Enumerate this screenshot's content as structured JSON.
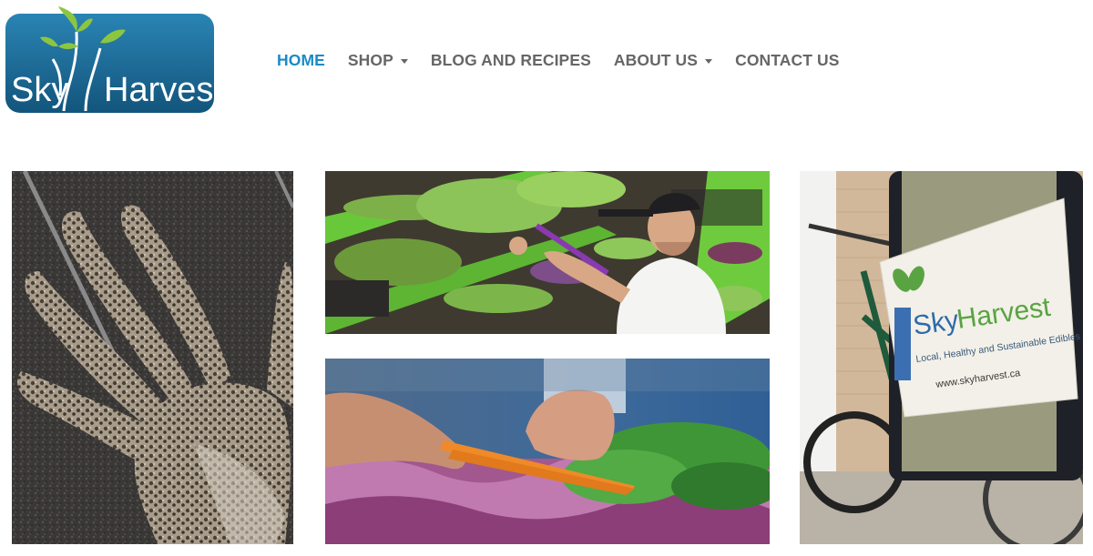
{
  "brand": {
    "logo_text_1": "Sky",
    "logo_text_2": "Harvest",
    "logo_bg": "#1a6d98",
    "leaf_color": "#8cc641"
  },
  "nav": {
    "items": [
      {
        "label": "HOME",
        "active": true,
        "dropdown": false
      },
      {
        "label": "SHOP",
        "active": false,
        "dropdown": true
      },
      {
        "label": "BLOG AND RECIPES",
        "active": false,
        "dropdown": false
      },
      {
        "label": "ABOUT US",
        "active": false,
        "dropdown": true
      },
      {
        "label": "CONTACT US",
        "active": false,
        "dropdown": false
      }
    ],
    "active_color": "#1a8ac8",
    "text_color": "#666666"
  },
  "gallery": {
    "bag_brand_1": "Sky",
    "bag_brand_2": "Harvest",
    "bag_tagline": "Local, Healthy and Sustainable Edibles",
    "bag_url": "www.skyharvest.ca"
  }
}
